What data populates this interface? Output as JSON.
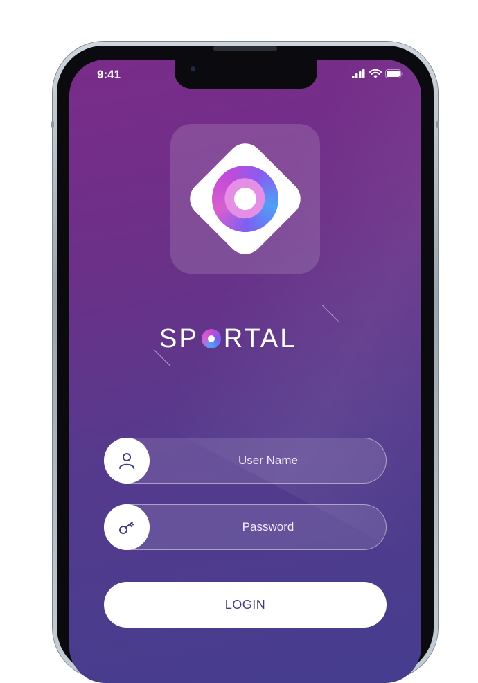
{
  "status_bar": {
    "time": "9:41",
    "icons": [
      "cellular-signal-icon",
      "wifi-icon",
      "battery-icon"
    ]
  },
  "app": {
    "brand_prefix": "SP",
    "brand_suffix": "RTAL",
    "logo_icon": "sportal-logo-icon"
  },
  "form": {
    "username_placeholder": "User Name",
    "username_icon": "user-icon",
    "password_placeholder": "Password",
    "password_icon": "key-icon",
    "login_label": "LOGIN"
  },
  "colors": {
    "gradient_top": "#7a2c8a",
    "gradient_bottom": "#453d8e",
    "button_text": "#4a3a7a",
    "icon_stroke": "#3d3f7a"
  }
}
